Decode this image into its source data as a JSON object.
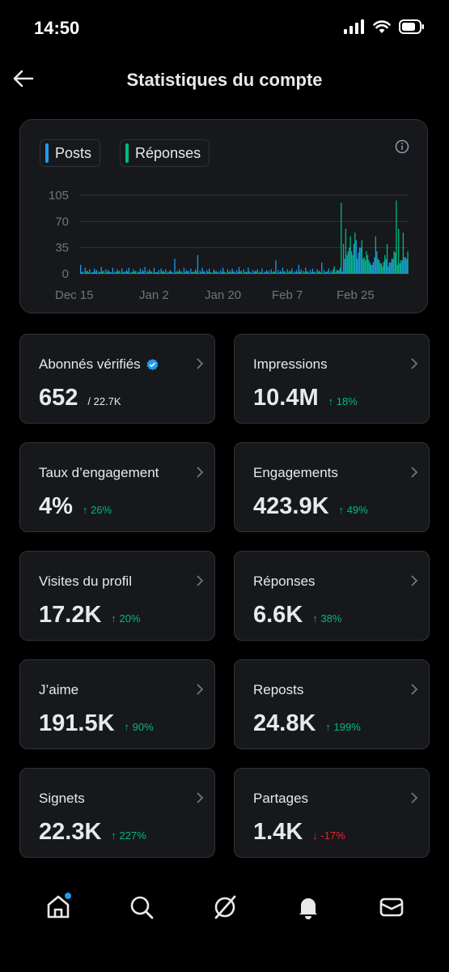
{
  "status_bar": {
    "time": "14:50"
  },
  "header": {
    "title": "Statistiques du compte"
  },
  "chart": {
    "legend": [
      {
        "label": "Posts",
        "color": "#1d9bf0"
      },
      {
        "label": "Réponses",
        "color": "#00ba7c"
      }
    ]
  },
  "chart_data": {
    "type": "bar",
    "y_ticks": [
      "105",
      "70",
      "35",
      "0"
    ],
    "x_ticks": [
      "Dec 15",
      "Jan 2",
      "Jan 20",
      "Feb 7",
      "Feb 25"
    ],
    "ylim": [
      0,
      105
    ],
    "series": [
      {
        "name": "Posts",
        "color": "#1d9bf0",
        "values": [
          12,
          3,
          8,
          4,
          6,
          2,
          7,
          5,
          3,
          9,
          4,
          6,
          5,
          2,
          8,
          3,
          6,
          4,
          7,
          3,
          5,
          8,
          2,
          6,
          4,
          3,
          7,
          5,
          9,
          4,
          6,
          3,
          8,
          2,
          5,
          7,
          4,
          6,
          3,
          5,
          2,
          20,
          4,
          6,
          3,
          8,
          5,
          4,
          7,
          3,
          6,
          25,
          4,
          8,
          3,
          5,
          7,
          2,
          6,
          4,
          3,
          5,
          8,
          2,
          6,
          4,
          7,
          3,
          5,
          9,
          4,
          6,
          3,
          8,
          2,
          5,
          4,
          6,
          3,
          7,
          2,
          5,
          4,
          6,
          3,
          18,
          5,
          4,
          8,
          3,
          6,
          4,
          7,
          3,
          5,
          12,
          6,
          4,
          8,
          3,
          5,
          7,
          3,
          6,
          4,
          15,
          5,
          3,
          7,
          4,
          6,
          2,
          5,
          8,
          3,
          20,
          25,
          35,
          30,
          40,
          45,
          28,
          35,
          20,
          18,
          25,
          15,
          12,
          22,
          30,
          18,
          14,
          16,
          20,
          10,
          15,
          20,
          28,
          12,
          14,
          18,
          22,
          20
        ]
      },
      {
        "name": "Réponses",
        "color": "#00ba7c",
        "values": [
          2,
          1,
          3,
          2,
          1,
          2,
          3,
          1,
          2,
          3,
          1,
          2,
          3,
          2,
          1,
          2,
          3,
          1,
          2,
          2,
          3,
          1,
          2,
          3,
          1,
          2,
          2,
          3,
          1,
          2,
          3,
          1,
          2,
          2,
          1,
          3,
          2,
          1,
          2,
          3,
          1,
          2,
          2,
          3,
          1,
          2,
          3,
          1,
          2,
          2,
          3,
          1,
          2,
          3,
          1,
          2,
          2,
          1,
          3,
          2,
          1,
          2,
          3,
          1,
          2,
          2,
          3,
          1,
          2,
          3,
          1,
          2,
          2,
          3,
          1,
          2,
          3,
          1,
          2,
          1,
          3,
          2,
          1,
          2,
          3,
          1,
          2,
          2,
          3,
          1,
          2,
          3,
          1,
          2,
          2,
          3,
          1,
          2,
          3,
          1,
          2,
          2,
          1,
          3,
          2,
          1,
          2,
          3,
          1,
          2,
          10,
          5,
          4,
          95,
          40,
          60,
          30,
          50,
          25,
          55,
          20,
          35,
          45,
          22,
          30,
          18,
          12,
          16,
          50,
          20,
          14,
          10,
          25,
          40,
          15,
          20,
          30,
          98,
          60,
          18,
          55,
          22,
          30
        ]
      }
    ]
  },
  "cards": [
    {
      "label": "Abonnés vérifiés",
      "value": "652",
      "total": "/ 22.7K",
      "verified": true
    },
    {
      "label": "Impressions",
      "value": "10.4M",
      "delta": "↑ 18%",
      "trend": "up"
    },
    {
      "label": "Taux d’engagement",
      "value": "4%",
      "delta": "↑ 26%",
      "trend": "up"
    },
    {
      "label": "Engagements",
      "value": "423.9K",
      "delta": "↑ 49%",
      "trend": "up"
    },
    {
      "label": "Visites du profil",
      "value": "17.2K",
      "delta": "↑ 20%",
      "trend": "up"
    },
    {
      "label": "Réponses",
      "value": "6.6K",
      "delta": "↑ 38%",
      "trend": "up"
    },
    {
      "label": "J’aime",
      "value": "191.5K",
      "delta": "↑ 90%",
      "trend": "up"
    },
    {
      "label": "Reposts",
      "value": "24.8K",
      "delta": "↑ 199%",
      "trend": "up"
    },
    {
      "label": "Signets",
      "value": "22.3K",
      "delta": "↑ 227%",
      "trend": "up"
    },
    {
      "label": "Partages",
      "value": "1.4K",
      "delta": "↓ -17%",
      "trend": "down"
    }
  ],
  "nav": [
    "home-icon",
    "search-icon",
    "grok-icon",
    "bell-icon",
    "mail-icon"
  ],
  "colors": {
    "accent": "#1d9bf0",
    "up": "#00ba7c",
    "down": "#f4212e",
    "card_bg": "#16181c",
    "border": "#2f3336"
  }
}
